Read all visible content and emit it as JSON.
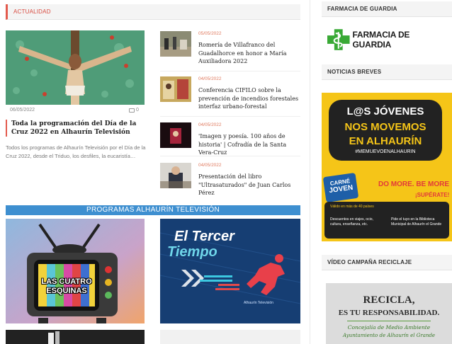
{
  "main": {
    "section_title": "ACTUALIDAD",
    "featured": {
      "date": "06/05/2022",
      "comments": "0",
      "title": "Toda la programación del Día de la Cruz 2022 en Alhaurín Televisión",
      "excerpt": "Todos los programas de Alhaurín Televisión por el Día de la Cruz 2022, desde el Triduo, los desfiles, la eucaristía…"
    },
    "news": [
      {
        "date": "05/05/2022",
        "title": "Romería de Villafranco del Guadalhorce en honor a María Auxiliadora 2022"
      },
      {
        "date": "04/05/2022",
        "title": "Conferencia CIFILO sobre la prevención de incendios forestales interfaz urbano-forestal"
      },
      {
        "date": "04/05/2022",
        "title": "'Imagen y poesía. 100 años de historia' | Cofradía de la Santa Vera-Cruz"
      },
      {
        "date": "04/05/2022",
        "title": "Presentación del libro \"Ultrasaturados\" de Juan Carlos Pérez"
      }
    ],
    "programs_title": "PROGRAMAS ALHAURÍN TELEVISIÓN",
    "programs": [
      {
        "title_line1": "LAS CUATRO",
        "title_line2": "ESQUINAS"
      },
      {
        "title_line1": "El Tercer",
        "title_line2": "Tiempo",
        "caption": "Alhaurín Televisión"
      }
    ]
  },
  "sidebar": {
    "pharmacy_header": "FARMACIA DE GUARDIA",
    "pharmacy_logo_text": "FARMACIA DE GUARDIA",
    "news_header": "NOTICIAS BREVES",
    "promo": {
      "line1": "L@S JÓVENES",
      "line2": "NOS MOVEMOS",
      "line3": "EN ALHAURÍN",
      "hashtag": "#MEMUEVOENALHAURIN",
      "card_label1": "CARNÉ",
      "card_label2": "JOVEN",
      "slogan1": "DO MORE. BE MORE",
      "slogan2": "¡SUPÉRATE!",
      "valid": "Válido en más de 40 países",
      "info1": "Descuentos en viajes, ocio, cultura, enseñanza, etc.",
      "info2": "Pide el tuyo en la Biblioteca Municipal de Alhaurín el Grande"
    },
    "video_header": "VÍDEO CAMPAÑA RECICLAJE",
    "video": {
      "title1": "RECICLA,",
      "title2": "ES TU RESPONSABILIDAD.",
      "sub1": "Concejalía de Medio Ambiente",
      "sub2": "Ayuntamiento de Alhaurín el Grande"
    }
  },
  "colors": {
    "accent_red": "#e35a4d",
    "accent_blue": "#3e8fd0",
    "pharmacy_green": "#39a935",
    "promo_yellow": "#f5c518"
  }
}
